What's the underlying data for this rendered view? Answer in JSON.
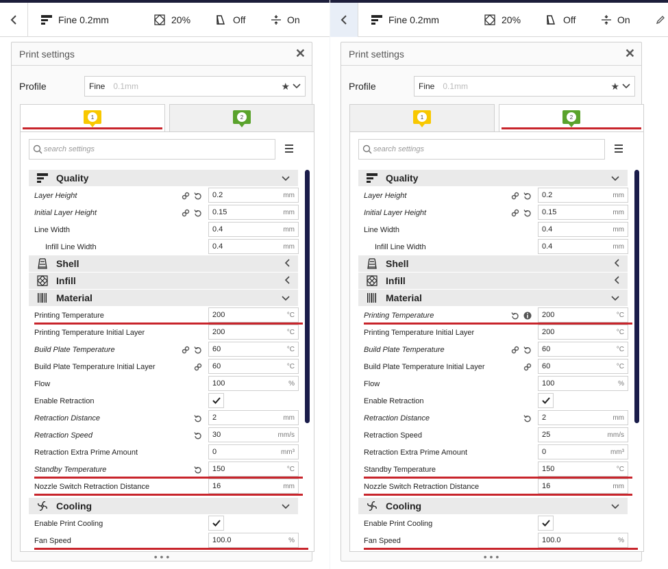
{
  "colors": {
    "accent_red": "#c8242b",
    "extruder1": "#f8c800",
    "extruder2": "#5aa32c",
    "scrollbar": "#1a1c4a",
    "topbar_border": "#1c1d3a"
  },
  "toolbar": {
    "back_icon": "chevron-left-icon",
    "quality_label": "Fine 0.2mm",
    "infill_label": "20%",
    "support_label": "Off",
    "adhesion_label": "On"
  },
  "panel": {
    "title": "Print settings",
    "profile_label": "Profile",
    "profile_name": "Fine",
    "profile_sub": "0.1mm",
    "search_placeholder": "search settings",
    "tab1": "1",
    "tab2": "2"
  },
  "left": {
    "active_tab": 1,
    "rows": [
      {
        "type": "cat",
        "label": "Quality",
        "icon": "quality-icon",
        "chev": "v"
      },
      {
        "type": "val",
        "label": "Layer Height",
        "it": true,
        "link": true,
        "reset": true,
        "value": "0.2",
        "unit": "mm"
      },
      {
        "type": "val",
        "label": "Initial Layer Height",
        "it": true,
        "link": true,
        "reset": true,
        "value": "0.15",
        "unit": "mm"
      },
      {
        "type": "val",
        "label": "Line Width",
        "value": "0.4",
        "unit": "mm"
      },
      {
        "type": "val",
        "label": "Infill Line Width",
        "ind": true,
        "value": "0.4",
        "unit": "mm"
      },
      {
        "type": "cat",
        "label": "Shell",
        "icon": "shell-icon",
        "chev": "<"
      },
      {
        "type": "cat",
        "label": "Infill",
        "icon": "infill-icon",
        "chev": "<"
      },
      {
        "type": "cat",
        "label": "Material",
        "icon": "material-icon",
        "chev": "v"
      },
      {
        "type": "val",
        "label": "Printing Temperature",
        "value": "200",
        "unit": "°C"
      },
      {
        "type": "val",
        "label": "Printing Temperature Initial Layer",
        "value": "200",
        "unit": "°C"
      },
      {
        "type": "val",
        "label": "Build Plate Temperature",
        "it": true,
        "link": true,
        "reset": true,
        "value": "60",
        "unit": "°C"
      },
      {
        "type": "val",
        "label": "Build Plate Temperature Initial Layer",
        "link": true,
        "value": "60",
        "unit": "°C"
      },
      {
        "type": "val",
        "label": "Flow",
        "value": "100",
        "unit": "%"
      },
      {
        "type": "chk",
        "label": "Enable Retraction"
      },
      {
        "type": "val",
        "label": "Retraction Distance",
        "it": true,
        "reset": true,
        "value": "2",
        "unit": "mm"
      },
      {
        "type": "val",
        "label": "Retraction Speed",
        "it": true,
        "reset": true,
        "value": "30",
        "unit": "mm/s"
      },
      {
        "type": "val",
        "label": "Retraction Extra Prime Amount",
        "value": "0",
        "unit": "mm³"
      },
      {
        "type": "val",
        "label": "Standby Temperature",
        "it": true,
        "reset": true,
        "value": "150",
        "unit": "°C"
      },
      {
        "type": "val",
        "label": "Nozzle Switch Retraction Distance",
        "value": "16",
        "unit": "mm"
      },
      {
        "type": "cat",
        "label": "Cooling",
        "icon": "cooling-icon",
        "chev": "v"
      },
      {
        "type": "chk",
        "label": "Enable Print Cooling"
      },
      {
        "type": "val",
        "label": "Fan Speed",
        "value": "100.0",
        "unit": "%"
      }
    ]
  },
  "right": {
    "active_tab": 2,
    "rows": [
      {
        "type": "cat",
        "label": "Quality",
        "icon": "quality-icon",
        "chev": "v"
      },
      {
        "type": "val",
        "label": "Layer Height",
        "it": true,
        "link": true,
        "reset": true,
        "value": "0.2",
        "unit": "mm"
      },
      {
        "type": "val",
        "label": "Initial Layer Height",
        "it": true,
        "link": true,
        "reset": true,
        "value": "0.15",
        "unit": "mm"
      },
      {
        "type": "val",
        "label": "Line Width",
        "value": "0.4",
        "unit": "mm"
      },
      {
        "type": "val",
        "label": "Infill Line Width",
        "ind": true,
        "value": "0.4",
        "unit": "mm"
      },
      {
        "type": "cat",
        "label": "Shell",
        "icon": "shell-icon",
        "chev": "<"
      },
      {
        "type": "cat",
        "label": "Infill",
        "icon": "infill-icon",
        "chev": "<"
      },
      {
        "type": "cat",
        "label": "Material",
        "icon": "material-icon",
        "chev": "v"
      },
      {
        "type": "val",
        "label": "Printing Temperature",
        "it": true,
        "reset": true,
        "info": true,
        "value": "200",
        "unit": "°C"
      },
      {
        "type": "val",
        "label": "Printing Temperature Initial Layer",
        "value": "200",
        "unit": "°C"
      },
      {
        "type": "val",
        "label": "Build Plate Temperature",
        "it": true,
        "link": true,
        "reset": true,
        "value": "60",
        "unit": "°C"
      },
      {
        "type": "val",
        "label": "Build Plate Temperature Initial Layer",
        "link": true,
        "value": "60",
        "unit": "°C"
      },
      {
        "type": "val",
        "label": "Flow",
        "value": "100",
        "unit": "%"
      },
      {
        "type": "chk",
        "label": "Enable Retraction"
      },
      {
        "type": "val",
        "label": "Retraction Distance",
        "it": true,
        "reset": true,
        "value": "2",
        "unit": "mm"
      },
      {
        "type": "val",
        "label": "Retraction Speed",
        "value": "25",
        "unit": "mm/s"
      },
      {
        "type": "val",
        "label": "Retraction Extra Prime Amount",
        "value": "0",
        "unit": "mm³"
      },
      {
        "type": "val",
        "label": "Standby Temperature",
        "value": "150",
        "unit": "°C"
      },
      {
        "type": "val",
        "label": "Nozzle Switch Retraction Distance",
        "value": "16",
        "unit": "mm"
      },
      {
        "type": "cat",
        "label": "Cooling",
        "icon": "cooling-icon",
        "chev": "v"
      },
      {
        "type": "chk",
        "label": "Enable Print Cooling"
      },
      {
        "type": "val",
        "label": "Fan Speed",
        "value": "100.0",
        "unit": "%"
      }
    ]
  }
}
